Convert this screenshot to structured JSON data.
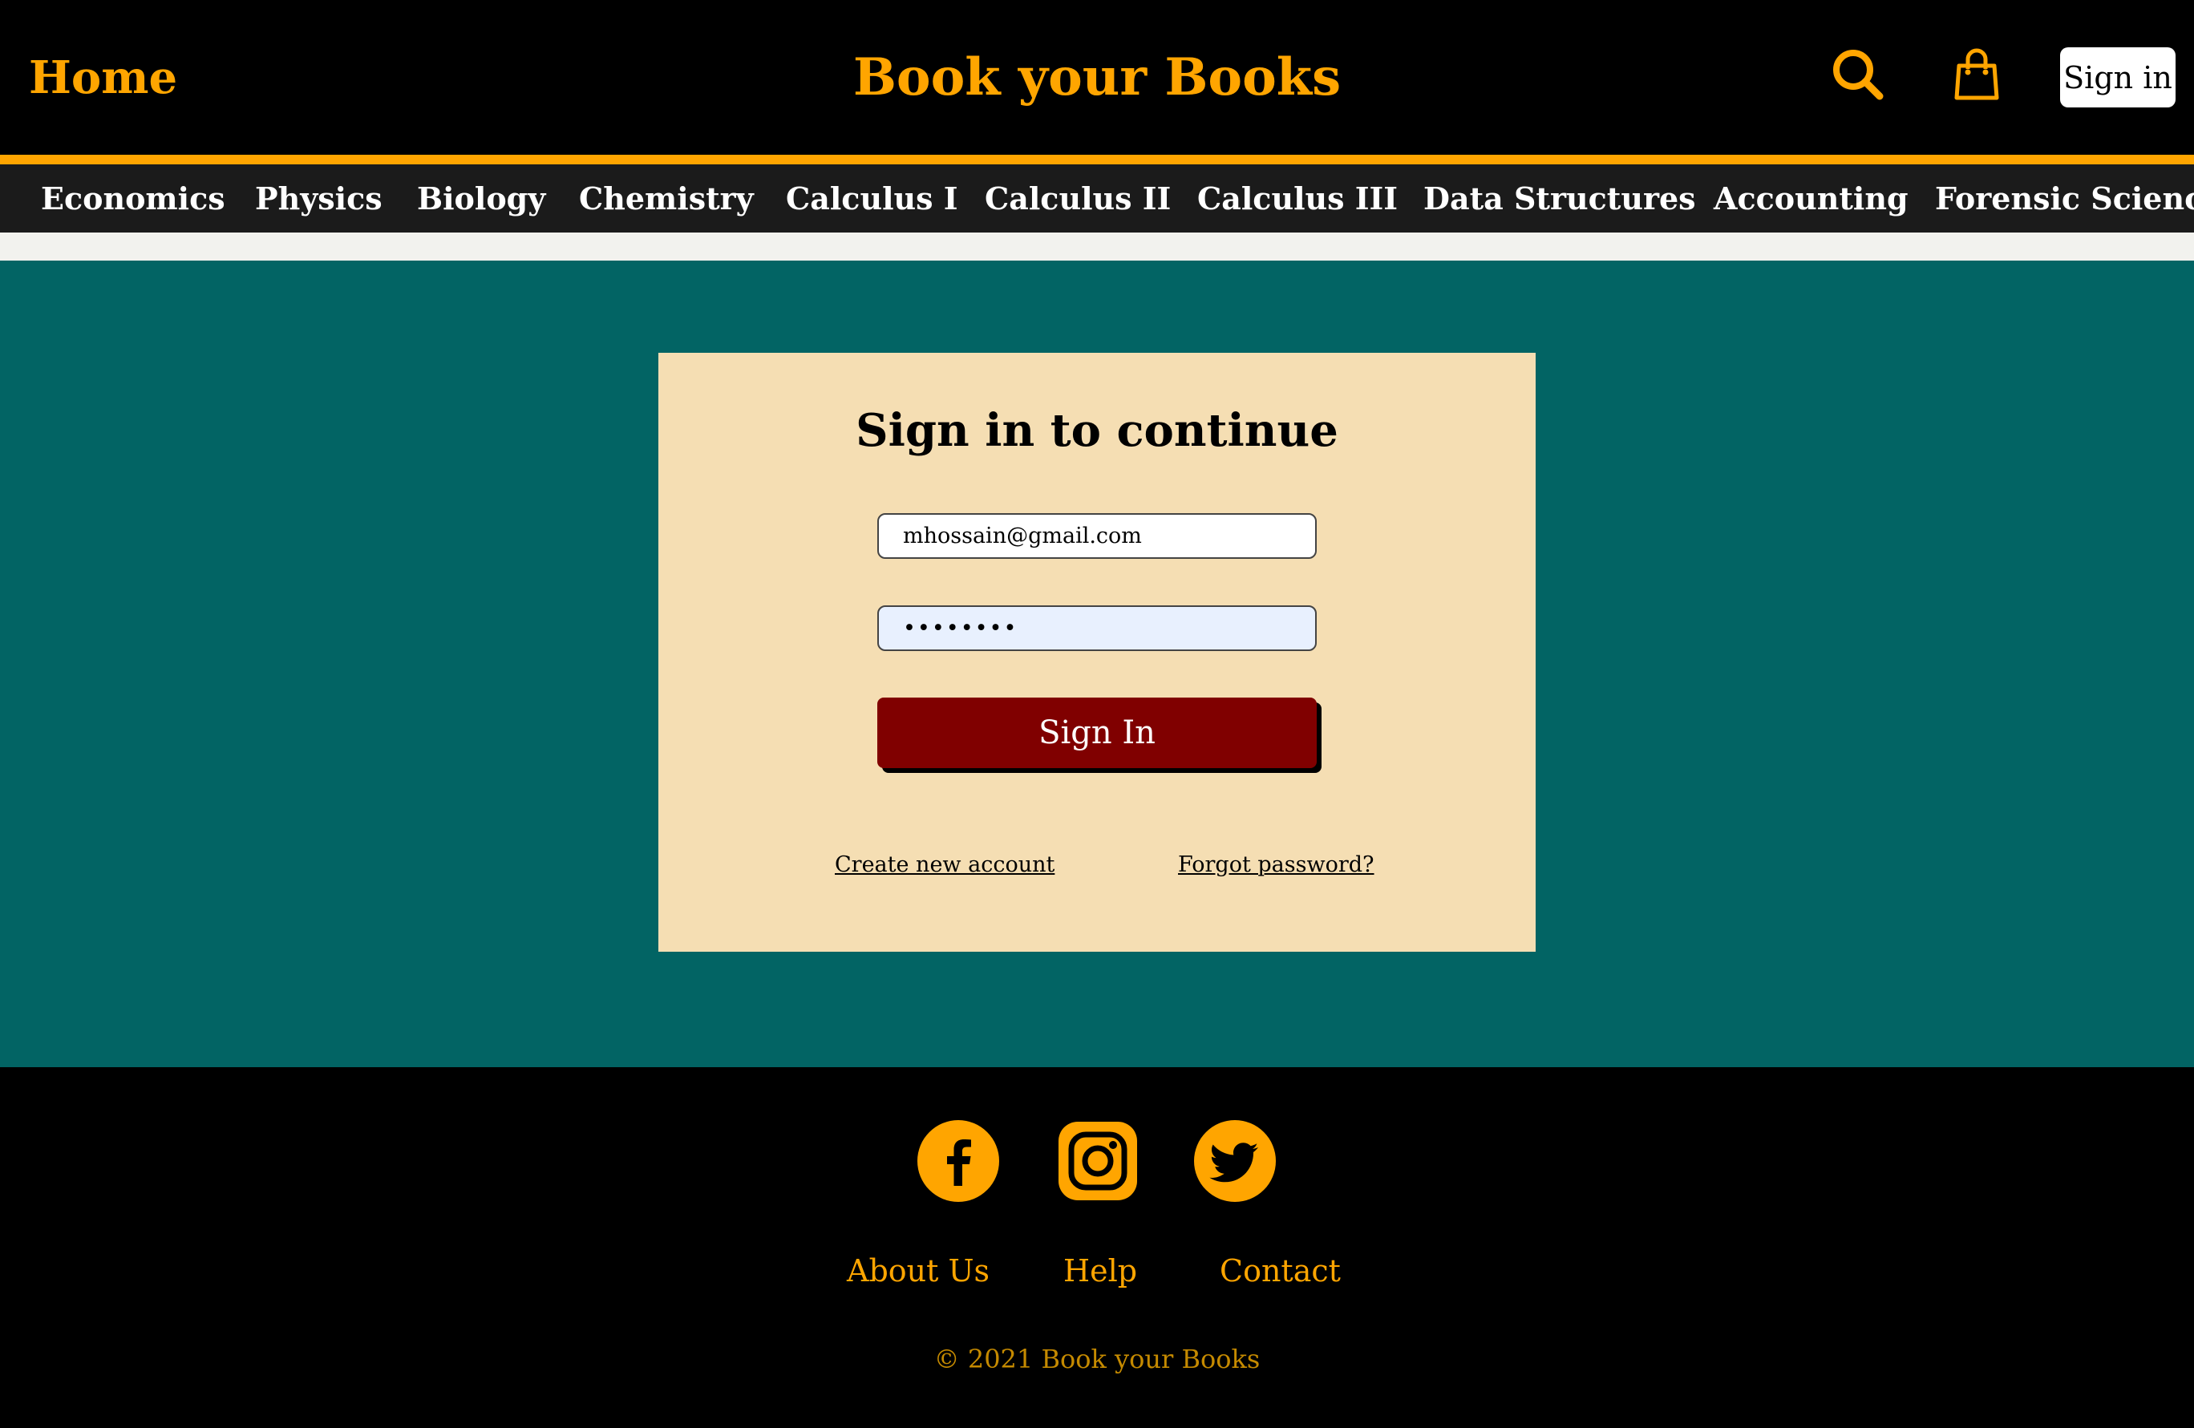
{
  "header": {
    "home_label": "Home",
    "site_title": "Book your Books",
    "signin_label": "Sign in",
    "icons": [
      "search-icon",
      "shopping-bag-icon"
    ]
  },
  "categories": [
    "Economics",
    "Physics",
    "Biology",
    "Chemistry",
    "Calculus I",
    "Calculus II",
    "Calculus III",
    "Data Structures",
    "Accounting",
    "Forensic Science"
  ],
  "signin_form": {
    "title": "Sign in to continue",
    "email_value": "mhossain@gmail.com",
    "password_value": "••••••••",
    "submit_label": "Sign In",
    "create_account_label": "Create new account",
    "forgot_password_label": "Forgot password?"
  },
  "footer": {
    "social_icons": [
      "facebook-icon",
      "instagram-icon",
      "twitter-icon"
    ],
    "links": [
      "About Us",
      "Help",
      "Contact"
    ],
    "copyright": "© 2021 Book your Books"
  },
  "colors": {
    "accent": "#FFA500",
    "header_bg": "#000000",
    "nav_bg": "#1b1b1b",
    "main_bg": "#026464",
    "card_bg": "#F5DEB3",
    "button_bg": "#800000"
  }
}
